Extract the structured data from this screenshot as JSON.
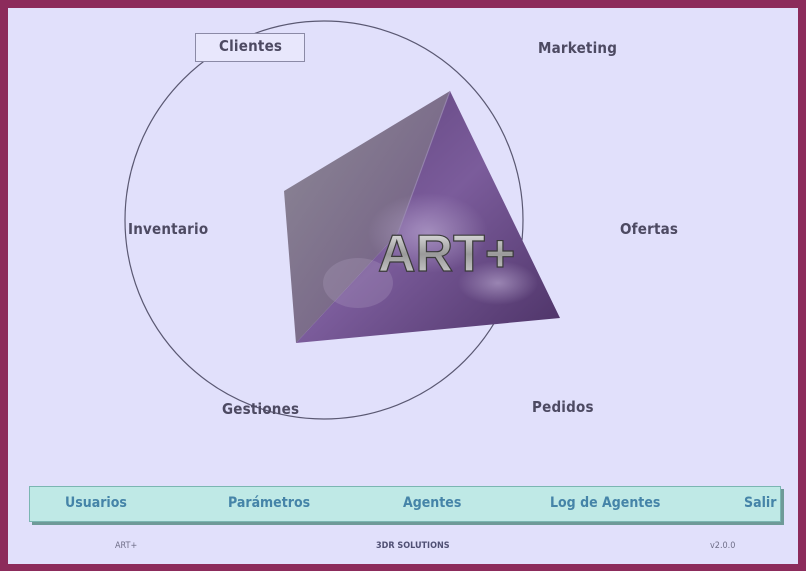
{
  "app_title": "ART+",
  "circle_menu": {
    "clientes": "Clientes",
    "marketing": "Marketing",
    "inventario": "Inventario",
    "ofertas": "Ofertas",
    "gestiones": "Gestiones",
    "pedidos": "Pedidos"
  },
  "logo_text": "ART+",
  "bottom_menu": {
    "usuarios": "Usuarios",
    "parametros": "Parámetros",
    "agentes": "Agentes",
    "log_agentes": "Log de Agentes",
    "salir": "Salir"
  },
  "footer": {
    "left": "ART+",
    "center": "3DR SOLUTIONS",
    "right": "v2.0.0"
  },
  "colors": {
    "border": "#8c2b5b",
    "background": "#e1e0fb",
    "menu_text": "#4d4a62",
    "bottom_bar": "#bfe9e6",
    "bottom_text": "#4584a8",
    "pyramid": "#6b4a88"
  }
}
